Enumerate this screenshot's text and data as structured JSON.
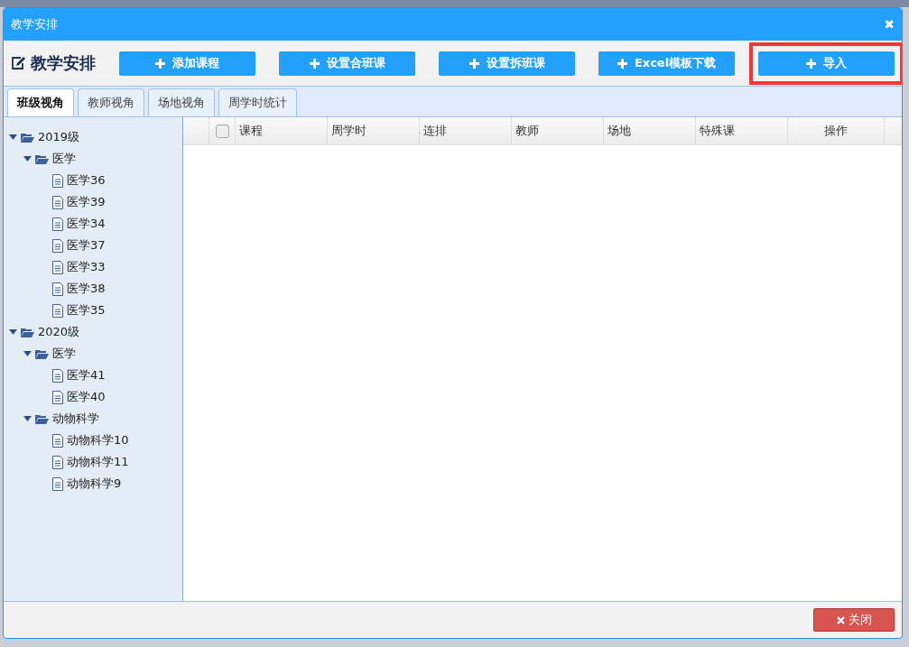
{
  "window": {
    "title": "教学安排",
    "close_glyph": "✖"
  },
  "header": {
    "title": "教学安排"
  },
  "toolbar": [
    {
      "label": "添加课程",
      "highlighted": false
    },
    {
      "label": "设置合班课",
      "highlighted": false
    },
    {
      "label": "设置拆班课",
      "highlighted": false
    },
    {
      "label": "Excel模板下载",
      "highlighted": false
    },
    {
      "label": "导入",
      "highlighted": true
    }
  ],
  "tabs": [
    {
      "label": "班级视角",
      "selected": true
    },
    {
      "label": "教师视角",
      "selected": false
    },
    {
      "label": "场地视角",
      "selected": false
    },
    {
      "label": "周学时统计",
      "selected": false
    }
  ],
  "tree": [
    {
      "label": "2019级",
      "expanded": true,
      "children": [
        {
          "label": "医学",
          "expanded": true,
          "children": [
            {
              "label": "医学36"
            },
            {
              "label": "医学39"
            },
            {
              "label": "医学34"
            },
            {
              "label": "医学37"
            },
            {
              "label": "医学33"
            },
            {
              "label": "医学38"
            },
            {
              "label": "医学35"
            }
          ]
        }
      ]
    },
    {
      "label": "2020级",
      "expanded": true,
      "children": [
        {
          "label": "医学",
          "expanded": true,
          "children": [
            {
              "label": "医学41"
            },
            {
              "label": "医学40"
            }
          ]
        },
        {
          "label": "动物科学",
          "expanded": true,
          "children": [
            {
              "label": "动物科学10"
            },
            {
              "label": "动物科学11"
            },
            {
              "label": "动物科学9"
            }
          ]
        }
      ]
    }
  ],
  "table": {
    "select_all": {
      "checked": false
    },
    "columns": [
      {
        "label": "课程"
      },
      {
        "label": "周学时"
      },
      {
        "label": "连排"
      },
      {
        "label": "教师"
      },
      {
        "label": "场地"
      },
      {
        "label": "特殊课"
      },
      {
        "label": "操作"
      }
    ]
  },
  "footer": {
    "close_button": "关闭"
  }
}
